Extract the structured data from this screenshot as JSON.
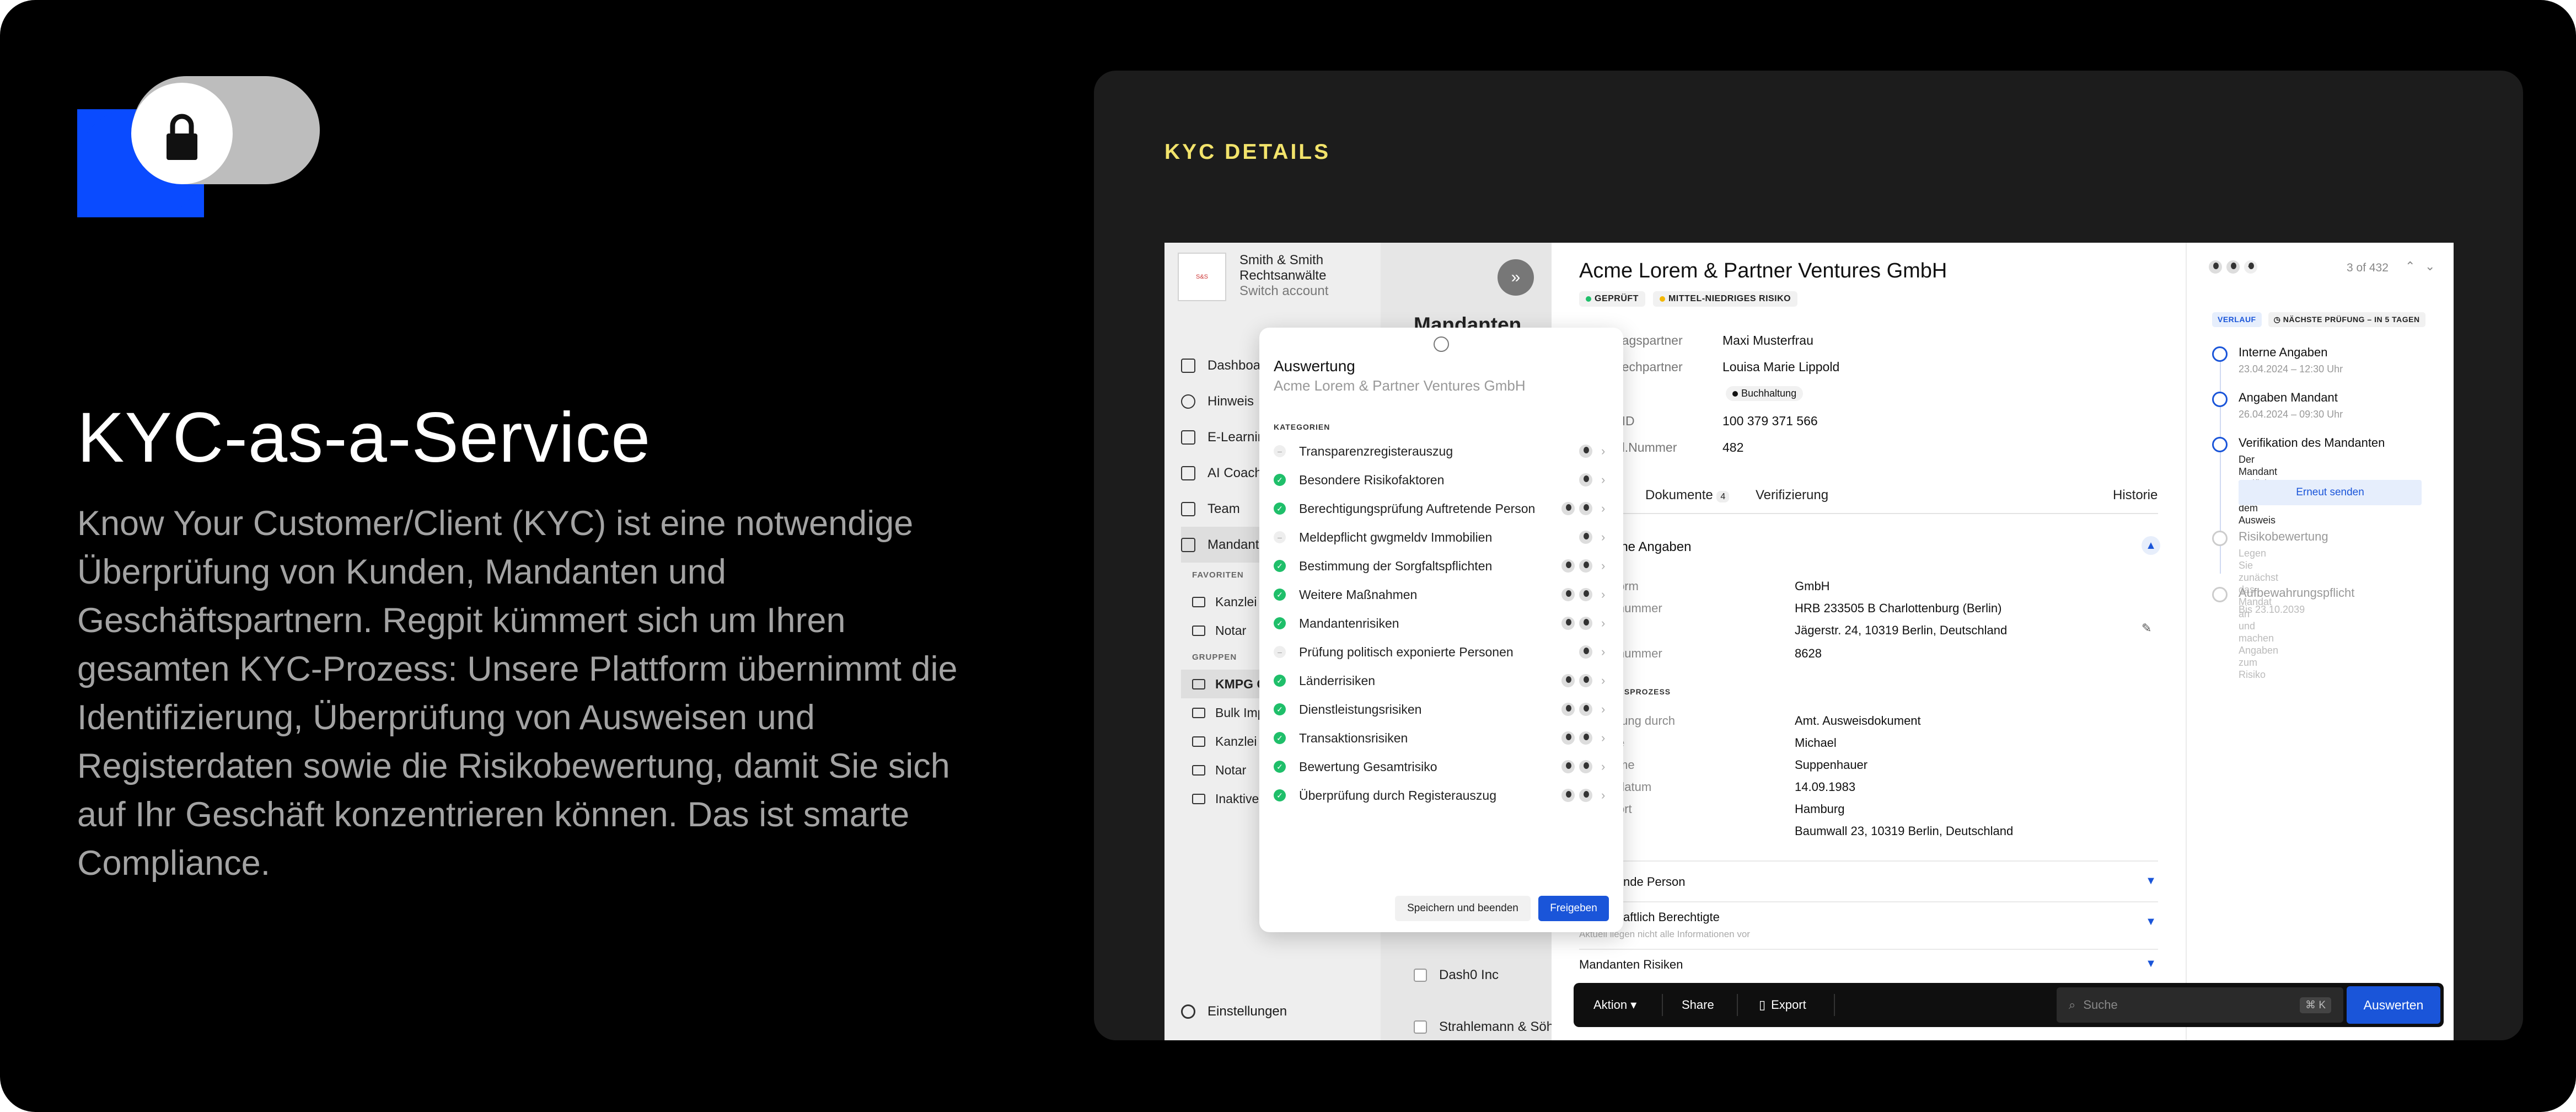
{
  "hero": {
    "headline": "KYC-as-a-Service",
    "body": "Know Your Customer/Client (KYC) ist eine notwendige Überprüfung von Kunden, Mandanten und Geschäftspartnern. Regpit kümmert sich um Ihren gesamten KYC-Prozess: Unsere Plattform übernimmt die Identifizierung, Überprüfung von Ausweisen und Registerdaten sowie die Risikobewertung, damit Sie sich auf Ihr Geschäft konzentrieren können. Das ist smarte Compliance."
  },
  "card": {
    "label": "KYC DETAILS"
  },
  "sidebar": {
    "firm_name": "Smith & Smith\nRechtsanwälte",
    "switch_account": "Switch account",
    "nav": [
      {
        "label": "Dashboa",
        "icon": "dashboard-icon"
      },
      {
        "label": "Hinweis",
        "icon": "alerts-icon"
      },
      {
        "label": "E-Learnin",
        "icon": "elearning-icon"
      },
      {
        "label": "AI Coach",
        "icon": "ai-coach-icon"
      },
      {
        "label": "Team",
        "icon": "team-icon"
      },
      {
        "label": "Mandant",
        "icon": "clients-icon"
      }
    ],
    "favorites_heading": "FAVORITEN",
    "favorites": [
      "Kanzlei N",
      "Notar"
    ],
    "groups_heading": "GRUPPEN",
    "groups": [
      "KMPG G",
      "Bulk Imp",
      "Kanzlei N",
      "Notar",
      "Inaktive"
    ],
    "settings": "Einstellungen"
  },
  "list": {
    "title": "Mandanten",
    "rows": [
      "Dash0 Inc",
      "Strahlemann & Söh"
    ]
  },
  "detail": {
    "company": "Acme Lorem & Partner Ventures GmbH",
    "badges": [
      "GEPRÜFT",
      "MITTEL-NIEDRIGES RISIKO"
    ],
    "kv": [
      {
        "label": "ragspartner",
        "value": "Maxi Musterfrau"
      },
      {
        "label": "rechpartner",
        "value": "Louisa Marie Lippold"
      },
      {
        "label": "",
        "value": "Buchhaltung"
      },
      {
        "label": "-ID",
        "value": "100 379 371 566"
      },
      {
        "label": "d.Nummer",
        "value": "482"
      }
    ],
    "tabs": [
      "Dokumente",
      "4",
      "Verifizierung",
      "Historie"
    ],
    "section1": "ine Angaben",
    "fields1": [
      {
        "label": "orm",
        "value": "GmbH"
      },
      {
        "label": "nummer",
        "value": "HRB 233505 B Charlottenburg (Berlin)"
      },
      {
        "label": "",
        "value": "Jägerstr. 24, 10319 Berlin, Deutschland"
      },
      {
        "label": "nummer",
        "value": "8628"
      }
    ],
    "section2": "GSPROZESS",
    "fields2": [
      {
        "label": "fung durch",
        "value": "Amt. Ausweisdokument"
      },
      {
        "label": "e",
        "value": "Michael"
      },
      {
        "label": "me",
        "value": "Suppenhauer"
      },
      {
        "label": "datum",
        "value": "14.09.1983"
      },
      {
        "label": "ort",
        "value": "Hamburg"
      },
      {
        "label": "",
        "value": "Baumwall 23, 10319 Berlin, Deutschland"
      }
    ],
    "collapsed": [
      {
        "title": "nde Person",
        "sub": ""
      },
      {
        "title": "aftlich Berechtigte",
        "sub": "Aktuell liegen nicht alle Informationen vor"
      },
      {
        "title": "Mandanten Risiken",
        "sub": ""
      }
    ]
  },
  "timeline": {
    "pager": "3 of 432",
    "chip_verlauf": "VERLAUF",
    "chip_next": "NÄCHSTE PRÜFUNG – IN 5 TAGEN",
    "items": [
      {
        "title": "Interne Angaben",
        "sub": "23.04.2024 – 12:30 Uhr",
        "state": "done"
      },
      {
        "title": "Angaben Mandant",
        "sub": "26.04.2024 – 09:30 Uhr",
        "state": "done"
      },
      {
        "title": "Verifikation des Mandanten",
        "sub": "Der Mandant verifiziert sich mit\ndem Ausweis",
        "state": "active"
      },
      {
        "title": "Risikobewertung",
        "sub": "Legen Sie zunächst das Mandat an\nund machen Angaben zum Risiko",
        "state": "pending"
      },
      {
        "title": "Aufbewahrungspflicht",
        "sub": "Bis 23.10.2039",
        "state": "pending"
      }
    ],
    "resend": "Erneut senden"
  },
  "toolbar": {
    "action": "Aktion ▾",
    "share": "Share",
    "export": "Export",
    "search_placeholder": "Suche",
    "kbd": "⌘ K",
    "submit": "Auswerten"
  },
  "modal": {
    "title": "Auswertung",
    "subtitle": "Acme Lorem & Partner Ventures GmbH",
    "category_heading": "KATEGORIEN",
    "rows": [
      {
        "label": "Transparenzregisterauszug",
        "state": "pending",
        "avatars": 1
      },
      {
        "label": "Besondere Risikofaktoren",
        "state": "ok",
        "avatars": 1
      },
      {
        "label": "Berechtigungsprüfung Auftretende Person",
        "state": "ok",
        "avatars": 2
      },
      {
        "label": "Meldepflicht gwgmeldv Immobilien",
        "state": "pending",
        "avatars": 1
      },
      {
        "label": "Bestimmung der Sorgfaltspflichten",
        "state": "ok",
        "avatars": 2
      },
      {
        "label": "Weitere Maßnahmen",
        "state": "ok",
        "avatars": 2
      },
      {
        "label": "Mandantenrisiken",
        "state": "ok",
        "avatars": 2
      },
      {
        "label": "Prüfung politisch exponierte Personen",
        "state": "pending",
        "avatars": 1
      },
      {
        "label": "Länderrisiken",
        "state": "ok",
        "avatars": 2
      },
      {
        "label": "Dienstleistungsrisiken",
        "state": "ok",
        "avatars": 2
      },
      {
        "label": "Transaktionsrisiken",
        "state": "ok",
        "avatars": 2
      },
      {
        "label": "Bewertung Gesamtrisiko",
        "state": "ok",
        "avatars": 2
      },
      {
        "label": "Überprüfung durch Registerauszug",
        "state": "ok",
        "avatars": 2
      }
    ],
    "save": "Speichern und beenden",
    "release": "Freigeben"
  },
  "colors": {
    "accent": "#1a55d9",
    "success": "#1fbf6a",
    "label_yellow": "#f2e36b",
    "logo_blue": "#0a4bff"
  }
}
